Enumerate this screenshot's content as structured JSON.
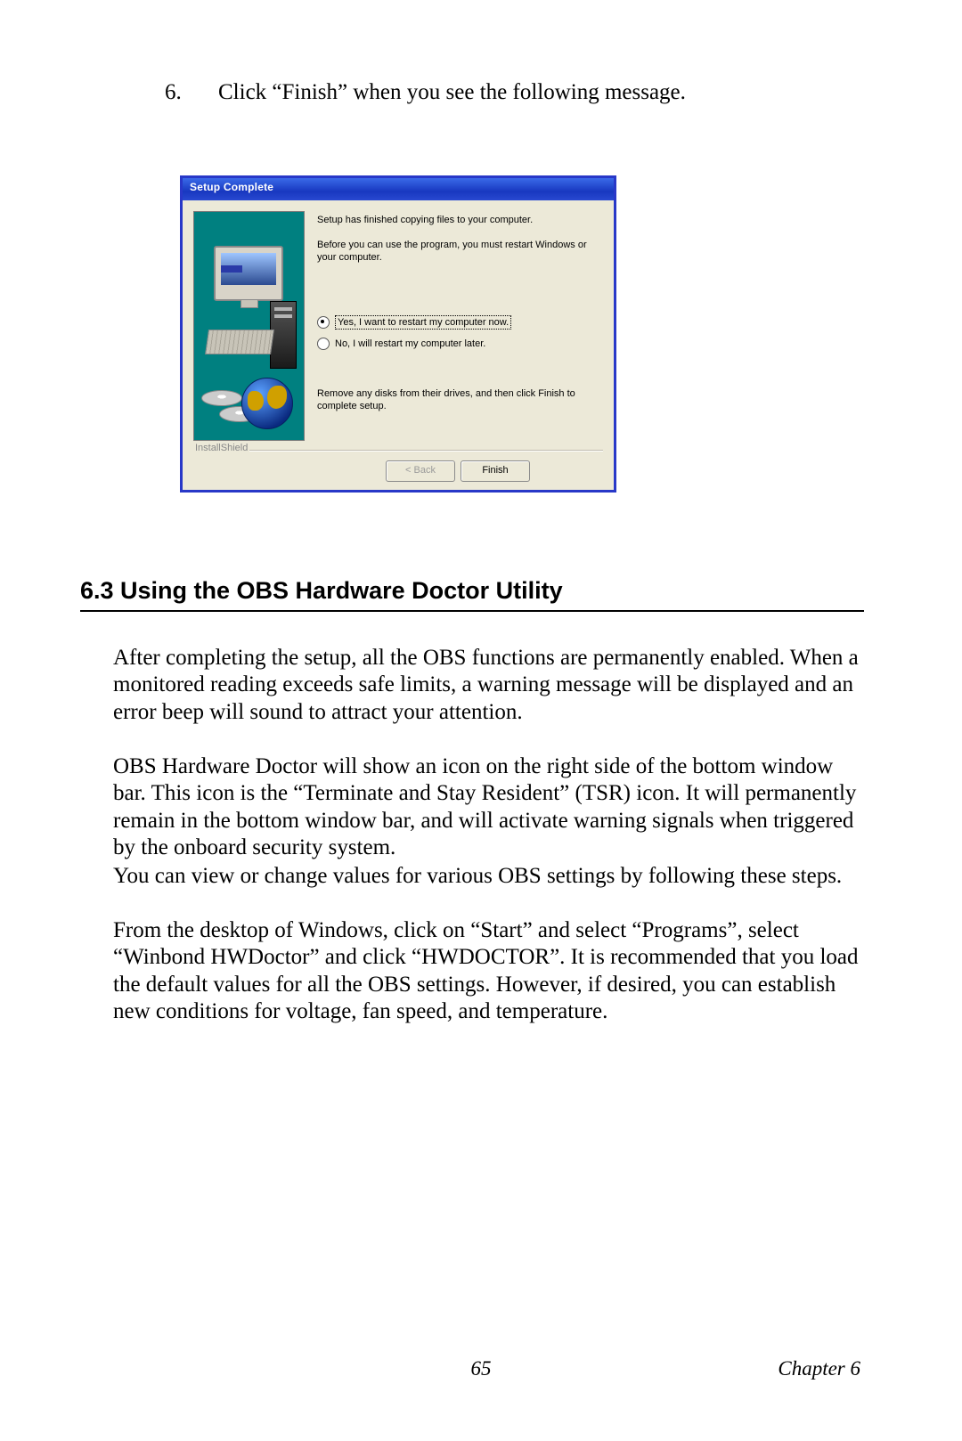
{
  "step": {
    "number": "6.",
    "text": "Click “Finish” when you see the following message."
  },
  "dialog": {
    "title": "Setup Complete",
    "line1": "Setup has finished copying files to your computer.",
    "line2": "Before you can use the program, you must restart Windows or your computer.",
    "radio_yes": "Yes, I want to restart my computer now.",
    "radio_no": "No, I will restart my computer later.",
    "line3": "Remove any disks from their drives, and then click Finish to complete setup.",
    "installshield": "InstallShield",
    "back": "< Back",
    "finish": "Finish"
  },
  "section": {
    "heading": "6.3  Using the OBS Hardware Doctor Utility",
    "p1": "After completing the setup, all the OBS functions are permanently enabled. When a monitored reading exceeds safe limits, a warning message will be displayed and an error beep will sound to attract your attention.",
    "p2": "OBS Hardware Doctor will show an icon on the right side of the bottom window bar. This icon is the “Terminate and Stay Resident” (TSR) icon. It will permanently remain in the bottom window bar, and will activate warning signals when triggered by the onboard security system.",
    "p3": "You can view or change values for various OBS settings by following these steps.",
    "p4": "From the desktop of Windows, click on “Start” and select “Programs”, select “Winbond HWDoctor” and click “HWDOCTOR”. It is recommended that you load the default values for all the OBS settings. However, if desired, you can establish new conditions for voltage, fan speed, and temperature."
  },
  "footer": {
    "page": "65",
    "chapter": "Chapter 6"
  }
}
